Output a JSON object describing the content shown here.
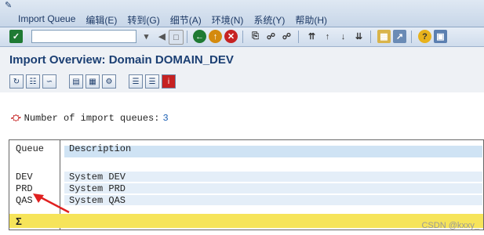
{
  "menu": [
    "Import Queue",
    "编辑(E)",
    "转到(G)",
    "细节(A)",
    "环境(N)",
    "系统(Y)",
    "帮助(H)"
  ],
  "toolbar": {
    "command_value": ""
  },
  "page": {
    "title": "Import Overview: Domain DOMAIN_DEV"
  },
  "info": {
    "label": "Number of import queues:",
    "count": "3"
  },
  "table": {
    "headers": [
      "Queue",
      "Description"
    ],
    "rows": [
      {
        "queue": "DEV",
        "desc": "System DEV"
      },
      {
        "queue": "PRD",
        "desc": "System PRD"
      },
      {
        "queue": "QAS",
        "desc": "System QAS"
      }
    ],
    "sum_icon": "Σ"
  },
  "watermark": "CSDN @kxxy_"
}
